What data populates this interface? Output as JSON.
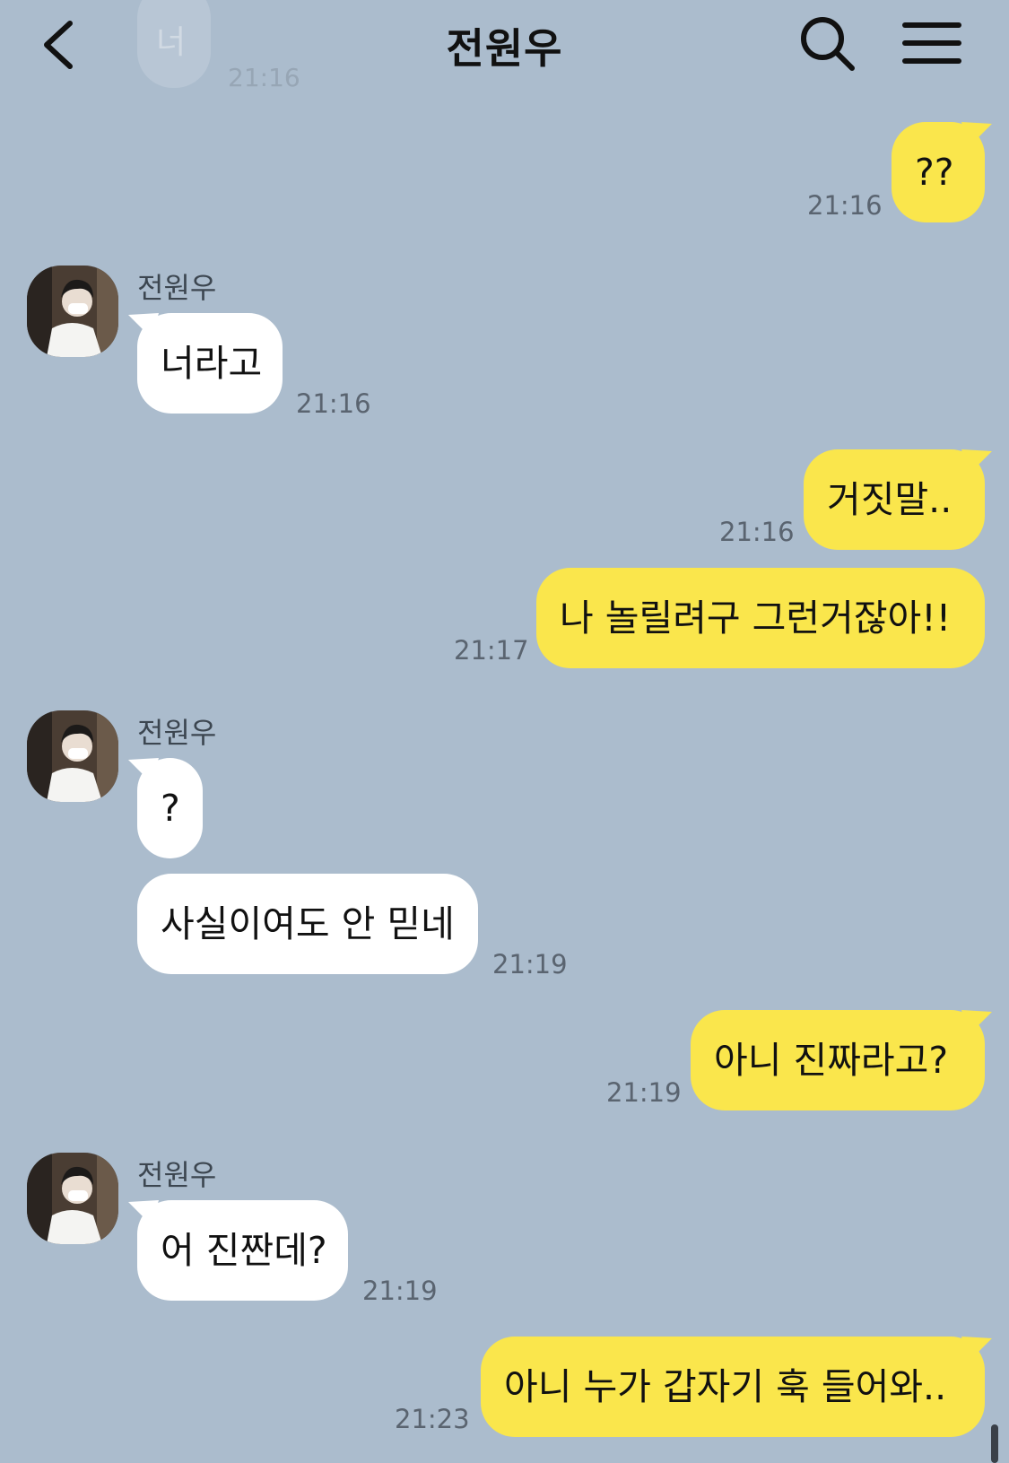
{
  "header": {
    "title": "전원우",
    "ghost_message": "너",
    "ghost_time": "21:16"
  },
  "messages": [
    {
      "dir": "out",
      "text": "??",
      "time": "21:16"
    },
    {
      "dir": "in",
      "sender": "전원우",
      "text": "너라고",
      "time": "21:16"
    },
    {
      "dir": "out",
      "text": "거짓말..",
      "time": "21:16"
    },
    {
      "dir": "out",
      "text": "나 놀릴려구 그런거잖아!!",
      "time": "21:17"
    },
    {
      "dir": "in",
      "sender": "전원우",
      "text": "?",
      "time": ""
    },
    {
      "dir": "in",
      "text": "사실이여도 안 믿네",
      "time": "21:19"
    },
    {
      "dir": "out",
      "text": "아니 진짜라고?",
      "time": "21:19"
    },
    {
      "dir": "in",
      "sender": "전원우",
      "text": "어 진짠데?",
      "time": "21:19"
    },
    {
      "dir": "out",
      "text": "아니 누가 갑자기 훅 들어와..",
      "time": "21:23"
    }
  ],
  "colors": {
    "background": "#abbccd",
    "outgoing_bubble": "#fae64c",
    "incoming_bubble": "#ffffff",
    "timestamp": "#5a6470"
  },
  "icons": {
    "back": "chevron-left-icon",
    "search": "search-icon",
    "menu": "hamburger-menu-icon",
    "avatar": "profile-photo"
  }
}
